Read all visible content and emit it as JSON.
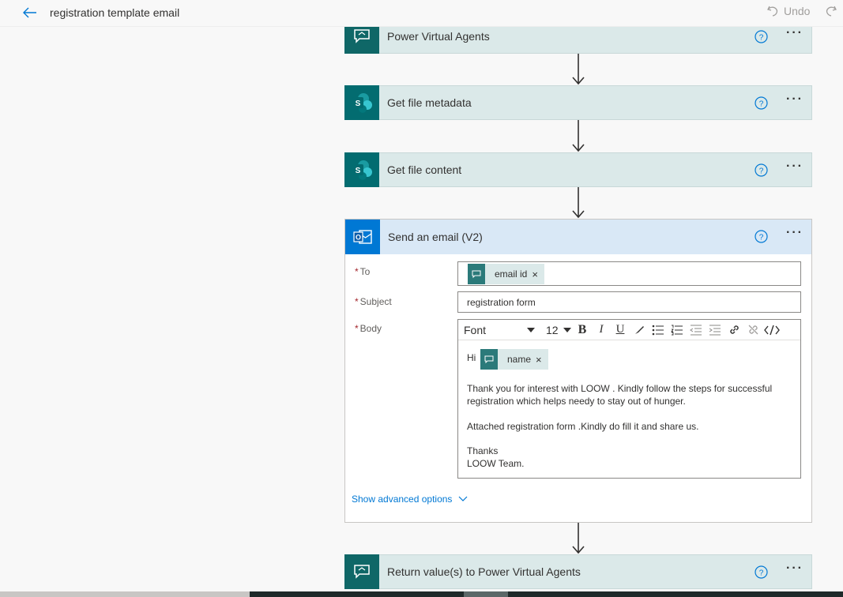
{
  "header": {
    "title": "registration template email",
    "undo_label": "Undo"
  },
  "steps": [
    {
      "title": "Power Virtual Agents",
      "icon": "power-virtual-agents-icon",
      "color": "#0f6767"
    },
    {
      "title": "Get file metadata",
      "icon": "sharepoint-icon",
      "color": "#036c70"
    },
    {
      "title": "Get file content",
      "icon": "sharepoint-icon",
      "color": "#036c70"
    },
    {
      "title": "Send an email (V2)",
      "icon": "outlook-icon",
      "color": "#0078d4"
    },
    {
      "title": "Return value(s) to Power Virtual Agents",
      "icon": "power-virtual-agents-icon",
      "color": "#0f6767"
    }
  ],
  "email": {
    "to_label": "To",
    "to_token": "email id",
    "subject_label": "Subject",
    "subject_value": "registration form",
    "body_label": "Body",
    "toolbar": {
      "font": "Font",
      "size": "12"
    },
    "greeting": "Hi",
    "name_token": "name",
    "para1_line1": "Thank you for interest with LOOW . Kindly follow the steps for successful",
    "para1_line2": "registration which helps needy to stay out of hunger.",
    "para2": "Attached registration form .Kindly do fill it and share us.",
    "closing1": "Thanks",
    "closing2": "LOOW Team.",
    "advanced_link": "Show advanced options",
    "required_mark": "*"
  },
  "colors": {
    "accent": "#0078d4",
    "teal": "#0f6767",
    "card_bg": "#dbe9e9",
    "email_header_bg": "#d9e8f6"
  }
}
